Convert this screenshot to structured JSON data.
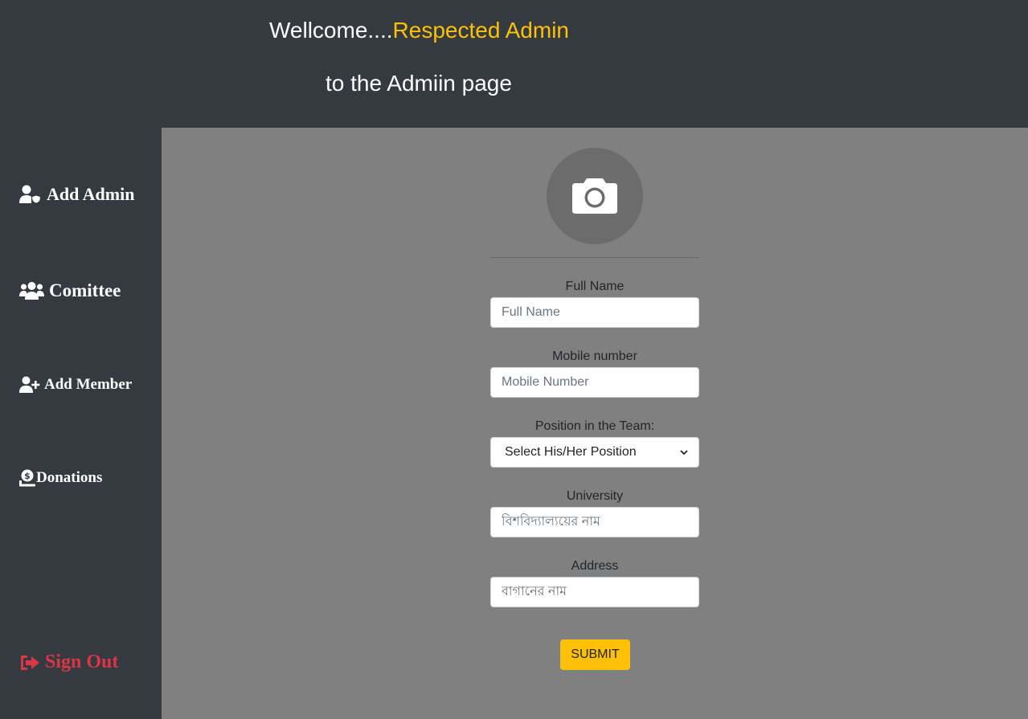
{
  "header": {
    "welcome_prefix": "Wellcome....",
    "welcome_accent": "Respected Admin",
    "subtitle": "to the Admiin page"
  },
  "sidebar": {
    "items": [
      {
        "label": "Add Admin",
        "icon": "user-shield-icon"
      },
      {
        "label": "Comittee",
        "icon": "users-icon"
      },
      {
        "label": "Add Member",
        "icon": "user-plus-icon"
      },
      {
        "label": "Donations",
        "icon": "donate-icon"
      }
    ],
    "signout": {
      "label": "Sign Out",
      "icon": "sign-out-icon"
    }
  },
  "form": {
    "photo_icon": "camera-icon",
    "full_name": {
      "label": "Full Name",
      "placeholder": "Full Name"
    },
    "mobile": {
      "label": "Mobile number",
      "placeholder": "Mobile Number"
    },
    "position": {
      "label": "Position in the Team:",
      "selected": "Select His/Her Position"
    },
    "university": {
      "label": "University",
      "placeholder": "বিশবিদ্যাল্যয়ের নাম"
    },
    "address": {
      "label": "Address",
      "placeholder": "বাগানের নাম"
    },
    "submit_label": "SUBMIT"
  },
  "colors": {
    "background_dark": "#343a40",
    "main_gray": "#808080",
    "accent_yellow": "#ffc107",
    "danger_red": "#dc3545"
  }
}
